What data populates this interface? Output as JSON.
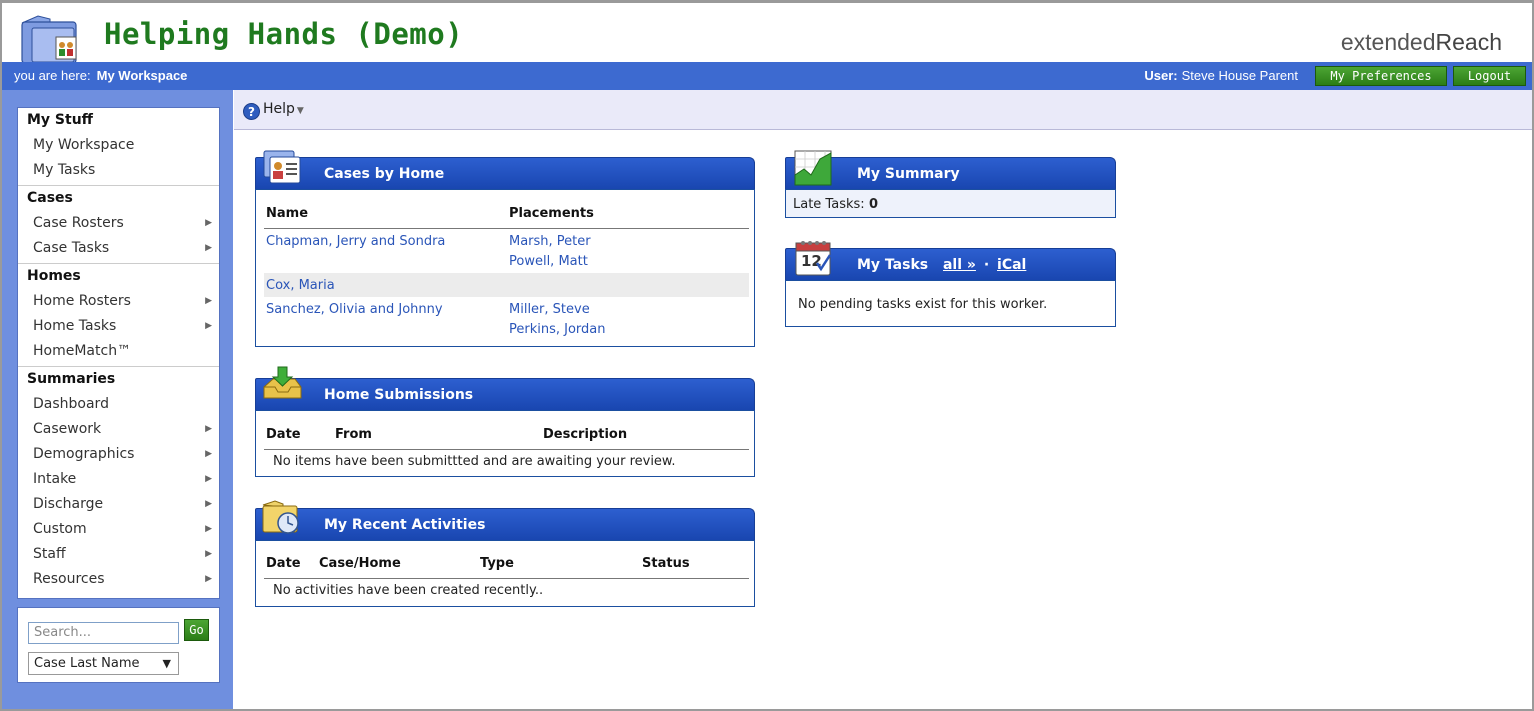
{
  "app": {
    "title": "Helping Hands (Demo)",
    "brand_light": "extended",
    "brand_bold": "Reach"
  },
  "bar": {
    "you_are_here_label": "you are here:",
    "location": "My Workspace",
    "user_label": "User:",
    "user_name": "Steve House Parent",
    "preferences_label": "My Preferences",
    "logout_label": "Logout",
    "accent": "#3d6ad0",
    "button_green": "#2b7d16"
  },
  "nav": {
    "my_stuff": {
      "title": "My Stuff",
      "items": [
        "My Workspace",
        "My Tasks"
      ]
    },
    "cases": {
      "title": "Cases",
      "items": [
        "Case Rosters",
        "Case Tasks"
      ]
    },
    "homes": {
      "title": "Homes",
      "items": [
        "Home Rosters",
        "Home Tasks",
        "HomeMatch™"
      ]
    },
    "summaries": {
      "title": "Summaries",
      "items": [
        "Dashboard",
        "Casework",
        "Demographics",
        "Intake",
        "Discharge",
        "Custom",
        "Staff",
        "Resources"
      ]
    }
  },
  "search": {
    "placeholder": "Search...",
    "go_label": "Go",
    "select_value": "Case Last Name"
  },
  "toolbar": {
    "help_label": "Help"
  },
  "cases_by_home": {
    "title": "Cases by Home",
    "columns": [
      "Name",
      "Placements"
    ],
    "rows": [
      {
        "name": "Chapman, Jerry and Sondra",
        "placements": [
          "Marsh, Peter",
          "Powell, Matt"
        ]
      },
      {
        "name": "Cox, Maria",
        "placements": []
      },
      {
        "name": "Sanchez, Olivia and Johnny",
        "placements": [
          "Miller, Steve",
          "Perkins, Jordan"
        ]
      }
    ]
  },
  "home_submissions": {
    "title": "Home Submissions",
    "columns": [
      "Date",
      "From",
      "Description"
    ],
    "empty": "No items have been submittted and are awaiting your review."
  },
  "recent_activities": {
    "title": "My Recent Activities",
    "columns": [
      "Date",
      "Case/Home",
      "Type",
      "Status"
    ],
    "empty": "No activities have been created recently.."
  },
  "summary": {
    "title": "My Summary",
    "late_tasks_label": "Late Tasks:",
    "late_tasks_value": "0"
  },
  "my_tasks": {
    "title": "My Tasks",
    "all_label": "all »",
    "dot": "·",
    "ical_label": "iCal",
    "empty": "No pending tasks exist for this worker."
  }
}
